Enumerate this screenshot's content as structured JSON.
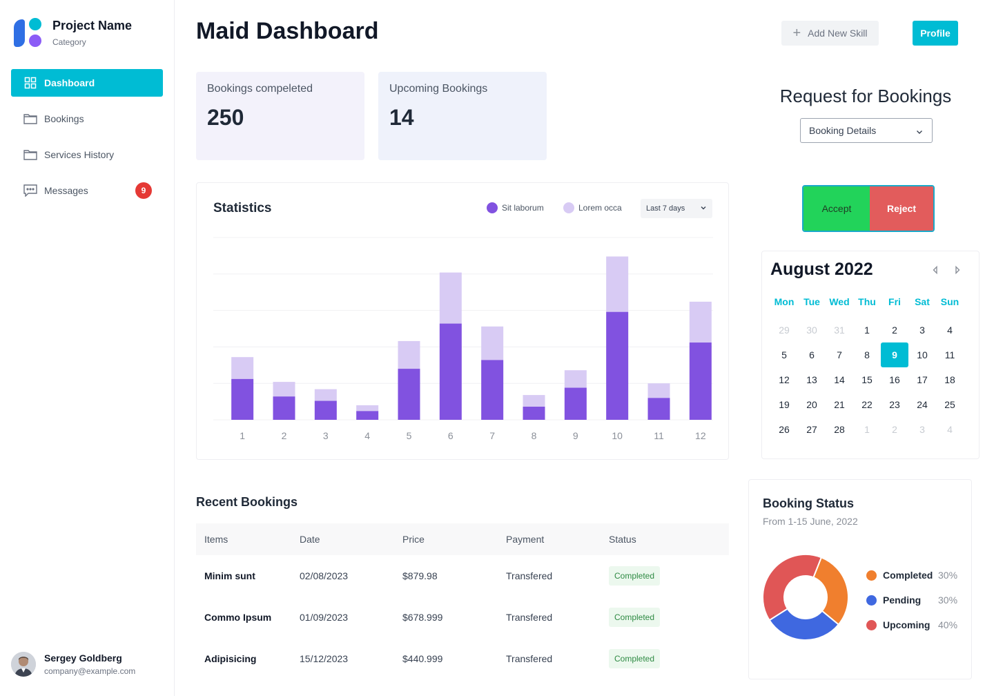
{
  "brand": {
    "name": "Project Name",
    "category": "Category"
  },
  "nav": {
    "items": [
      {
        "label": "Dashboard",
        "icon": "grid-icon",
        "active": true
      },
      {
        "label": "Bookings",
        "icon": "folder-icon"
      },
      {
        "label": "Services History",
        "icon": "folder-icon"
      },
      {
        "label": "Messages",
        "icon": "chat-icon",
        "badge": "9"
      }
    ]
  },
  "user": {
    "name": "Sergey Goldberg",
    "email": "company@example.com"
  },
  "header": {
    "title": "Maid Dashboard",
    "add_skill_label": "Add New Skill",
    "profile_label": "Profile"
  },
  "summary": {
    "completed": {
      "label": "Bookings compeleted",
      "value": "250"
    },
    "upcoming": {
      "label": "Upcoming Bookings",
      "value": "14"
    }
  },
  "statistics": {
    "title": "Statistics",
    "range": "Last 7 days"
  },
  "chart_data": {
    "type": "bar",
    "stacked": true,
    "categories": [
      "1",
      "2",
      "3",
      "4",
      "5",
      "6",
      "7",
      "8",
      "9",
      "10",
      "11",
      "12"
    ],
    "series": [
      {
        "name": "Sit laborum",
        "color": "#8152e0",
        "values": [
          28,
          16,
          13,
          6,
          35,
          66,
          41,
          9,
          22,
          74,
          15,
          53
        ]
      },
      {
        "name": "Lorem occa",
        "color": "#d8cbf4",
        "values": [
          43,
          26,
          21,
          10,
          54,
          101,
          64,
          17,
          34,
          112,
          25,
          81
        ]
      }
    ],
    "grid": true,
    "legend_position": "top-right"
  },
  "requests": {
    "title": "Request for Bookings",
    "select_value": "Booking Details",
    "accept_label": "Accept",
    "reject_label": "Reject"
  },
  "calendar": {
    "title": "August 2022",
    "weekdays": [
      "Mon",
      "Tue",
      "Wed",
      "Thu",
      "Fri",
      "Sat",
      "Sun"
    ],
    "weeks": [
      [
        "29",
        "30",
        "31",
        "1",
        "2",
        "3",
        "4"
      ],
      [
        "5",
        "6",
        "7",
        "8",
        "9",
        "10",
        "11"
      ],
      [
        "12",
        "13",
        "14",
        "15",
        "16",
        "17",
        "18"
      ],
      [
        "19",
        "20",
        "21",
        "22",
        "23",
        "24",
        "25"
      ],
      [
        "26",
        "27",
        "28",
        "1",
        "2",
        "3",
        "4"
      ]
    ],
    "selected": "9"
  },
  "recent": {
    "title": "Recent Bookings",
    "columns": [
      "Items",
      "Date",
      "Price",
      "Payment",
      "Status"
    ],
    "rows": [
      {
        "item": "Minim sunt",
        "date": "02/08/2023",
        "price": "$879.98",
        "payment": "Transfered",
        "status": "Completed"
      },
      {
        "item": "Commo Ipsum",
        "date": "01/09/2023",
        "price": "$678.999",
        "payment": "Transfered",
        "status": "Completed"
      },
      {
        "item": "Adipisicing",
        "date": "15/12/2023",
        "price": "$440.999",
        "payment": "Transfered",
        "status": "Completed"
      }
    ]
  },
  "booking_status": {
    "title": "Booking Status",
    "subtitle": "From 1-15 June, 2022",
    "segments": [
      {
        "name": "Completed",
        "percent": "30%",
        "value": 30,
        "color": "#f07f2e"
      },
      {
        "name": "Pending",
        "percent": "30%",
        "value": 30,
        "color": "#3f68e0"
      },
      {
        "name": "Upcoming",
        "percent": "40%",
        "value": 40,
        "color": "#e05656"
      }
    ]
  }
}
